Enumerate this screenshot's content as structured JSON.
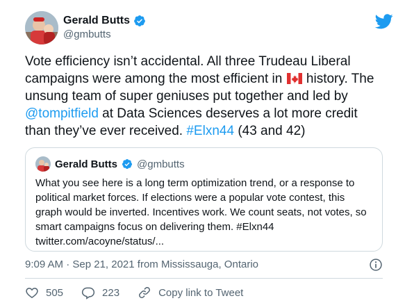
{
  "author": {
    "display_name": "Gerald Butts",
    "handle": "@gmbutts"
  },
  "tweet": {
    "text_part1": "Vote efficiency isn’t accidental. All three Trudeau Liberal campaigns were among the most efficient in",
    "text_part2": "history. The unsung team of super geniuses put together and led by",
    "mention": "@tompitfield",
    "text_part3": "at Data Sciences deserves a lot more credit than they’ve ever received.",
    "hashtag": "#Elxn44",
    "text_part4": "(43 and 42)"
  },
  "quote": {
    "display_name": "Gerald Butts",
    "handle": "@gmbutts",
    "text": "What you see here is a long term optimization trend, or a response to political market forces. If elections were a popular vote contest, this graph would be inverted. Incentives work. We count seats, not votes, so smart campaigns focus on delivering them. #Elxn44 twitter.com/acoyne/status/..."
  },
  "meta": {
    "timestamp": "9:09 AM · Sep 21, 2021 from Mississauga, Ontario"
  },
  "actions": {
    "likes": "505",
    "replies": "223",
    "copy_link_label": "Copy link to Tweet"
  },
  "colors": {
    "link": "#1d9bf0",
    "text": "#0f1419",
    "secondary": "#536471",
    "border": "#cfd9de"
  },
  "icons": [
    "verified-badge-icon",
    "twitter-bird-icon",
    "canada-flag-icon",
    "info-icon",
    "heart-icon",
    "reply-icon",
    "link-icon"
  ]
}
